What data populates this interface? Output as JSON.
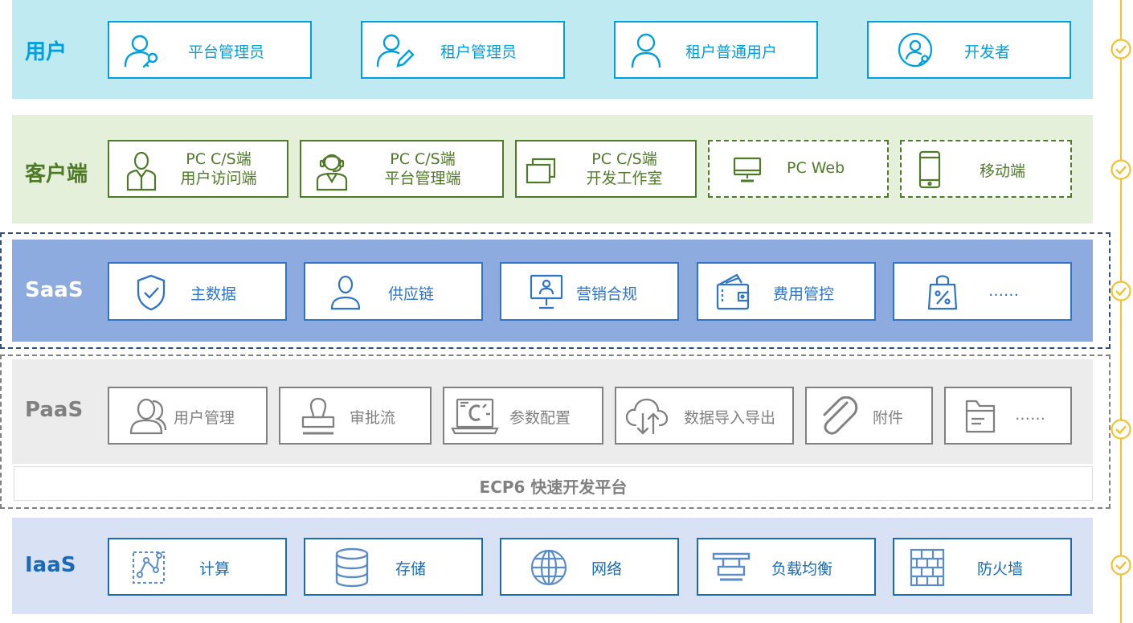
{
  "user": {
    "title": "用户",
    "items": [
      "平台管理员",
      "租户管理员",
      "租户普通用户",
      "开发者"
    ]
  },
  "client": {
    "title": "客户端",
    "items": [
      {
        "l1": "PC C/S端",
        "l2": "用户访问端"
      },
      {
        "l1": "PC C/S端",
        "l2": "平台管理端"
      },
      {
        "l1": "PC C/S端",
        "l2": "开发工作室"
      },
      {
        "l1": "PC Web",
        "l2": ""
      },
      {
        "l1": "移动端",
        "l2": ""
      }
    ]
  },
  "saas": {
    "title": "SaaS",
    "items": [
      "主数据",
      "供应链",
      "营销合规",
      "费用管控",
      "……"
    ]
  },
  "paas": {
    "title": "PaaS",
    "items": [
      "用户管理",
      "审批流",
      "参数配置",
      "数据导入导出",
      "附件",
      "……"
    ],
    "platform": "ECP6 快速开发平台"
  },
  "iaas": {
    "title": "IaaS",
    "items": [
      "计算",
      "存储",
      "网络",
      "负载均衡",
      "防火墙"
    ]
  },
  "colors": {
    "user_bg": "#bfeaf2",
    "user_accent": "#00a0e0",
    "client_bg": "#e4f0d9",
    "client_accent": "#4f7a28",
    "saas_bg": "#8eabdf",
    "saas_accent": "#2f74c6",
    "paas_bg": "#ececec",
    "paas_accent": "#808080",
    "iaas_bg": "#d8e2f4",
    "iaas_accent": "#1a6ab5",
    "timeline": "#f2c230"
  }
}
